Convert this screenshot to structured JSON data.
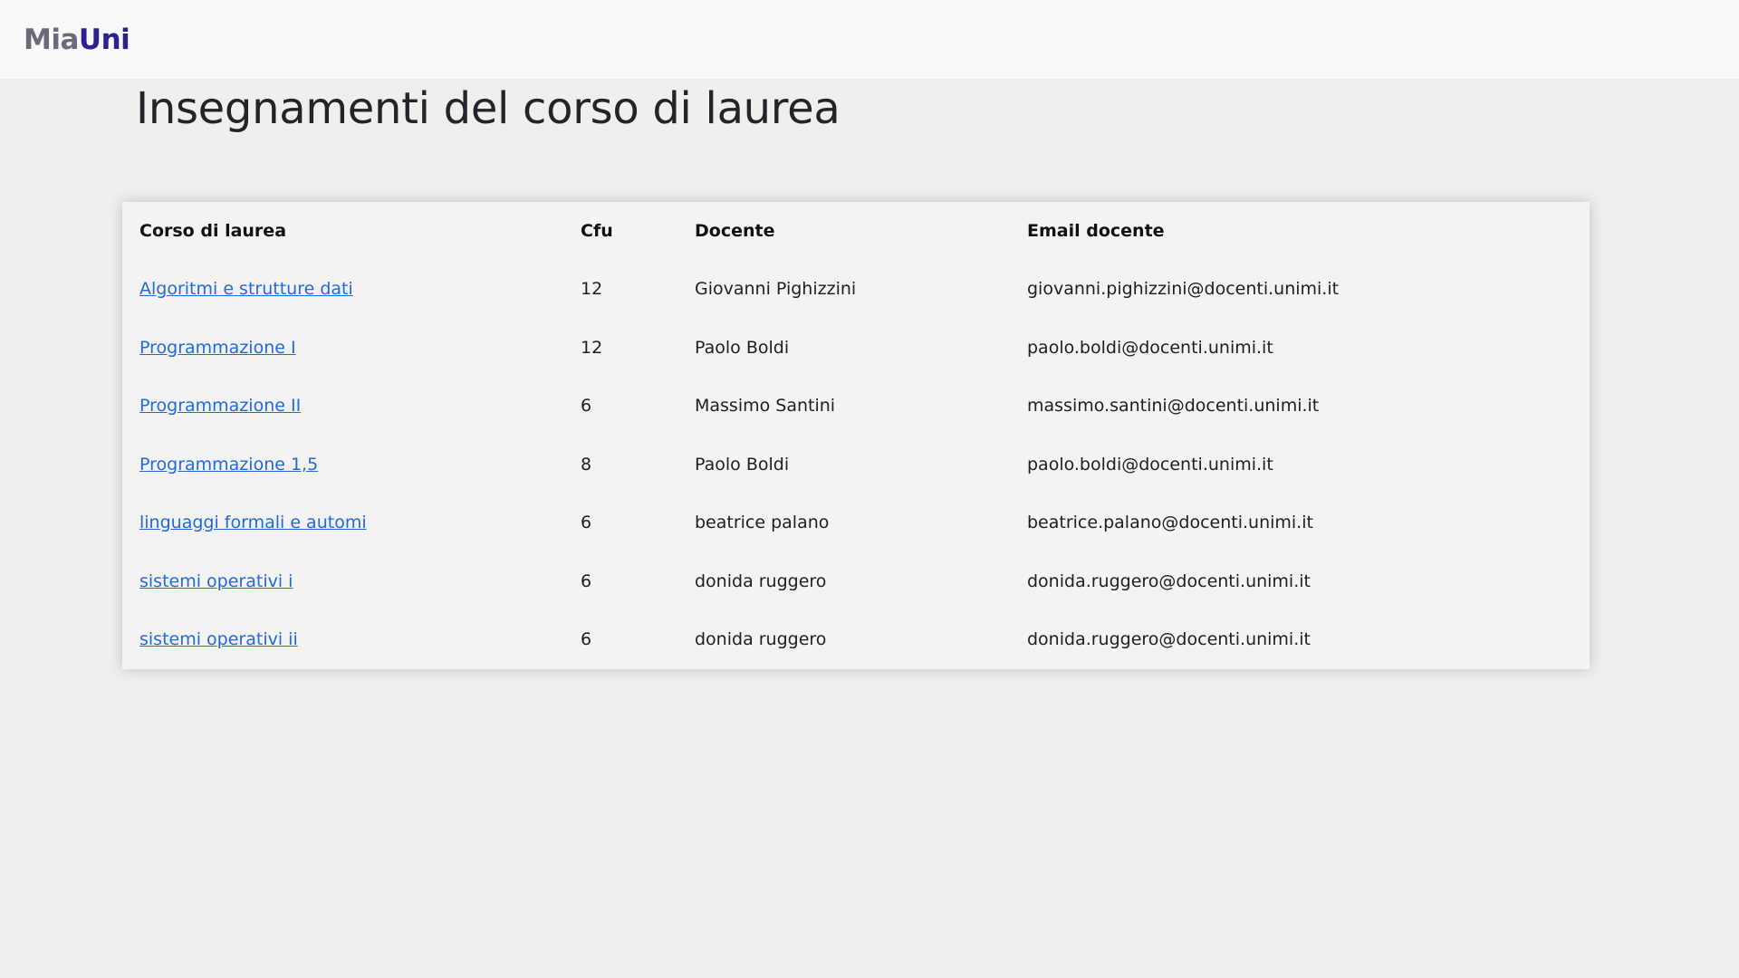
{
  "navbar": {
    "brand_part1": "Mia",
    "brand_part2": "Uni"
  },
  "page": {
    "title": "Insegnamenti del corso di laurea"
  },
  "table": {
    "headers": [
      "Corso di laurea",
      "Cfu",
      "Docente",
      "Email docente"
    ],
    "rows": [
      {
        "course": "Algoritmi e strutture dati",
        "cfu": "12",
        "teacher": "Giovanni Pighizzini",
        "email": "giovanni.pighizzini@docenti.unimi.it"
      },
      {
        "course": "Programmazione I",
        "cfu": "12",
        "teacher": "Paolo Boldi",
        "email": "paolo.boldi@docenti.unimi.it"
      },
      {
        "course": "Programmazione II",
        "cfu": "6",
        "teacher": "Massimo Santini",
        "email": "massimo.santini@docenti.unimi.it"
      },
      {
        "course": "Programmazione 1,5",
        "cfu": "8",
        "teacher": "Paolo Boldi",
        "email": "paolo.boldi@docenti.unimi.it"
      },
      {
        "course": "linguaggi formali e automi",
        "cfu": "6",
        "teacher": "beatrice palano",
        "email": "beatrice.palano@docenti.unimi.it"
      },
      {
        "course": "sistemi operativi i",
        "cfu": "6",
        "teacher": "donida ruggero",
        "email": "donida.ruggero@docenti.unimi.it"
      },
      {
        "course": "sistemi operativi ii",
        "cfu": "6",
        "teacher": "donida ruggero",
        "email": "donida.ruggero@docenti.unimi.it"
      }
    ]
  },
  "colors": {
    "background": "#f0efee",
    "navbar": "#f8f9fa",
    "brand_mia": "#6c6a78",
    "brand_uni": "#2e1f8e",
    "link": "#1f6be0",
    "card": "#f4f2f3"
  }
}
